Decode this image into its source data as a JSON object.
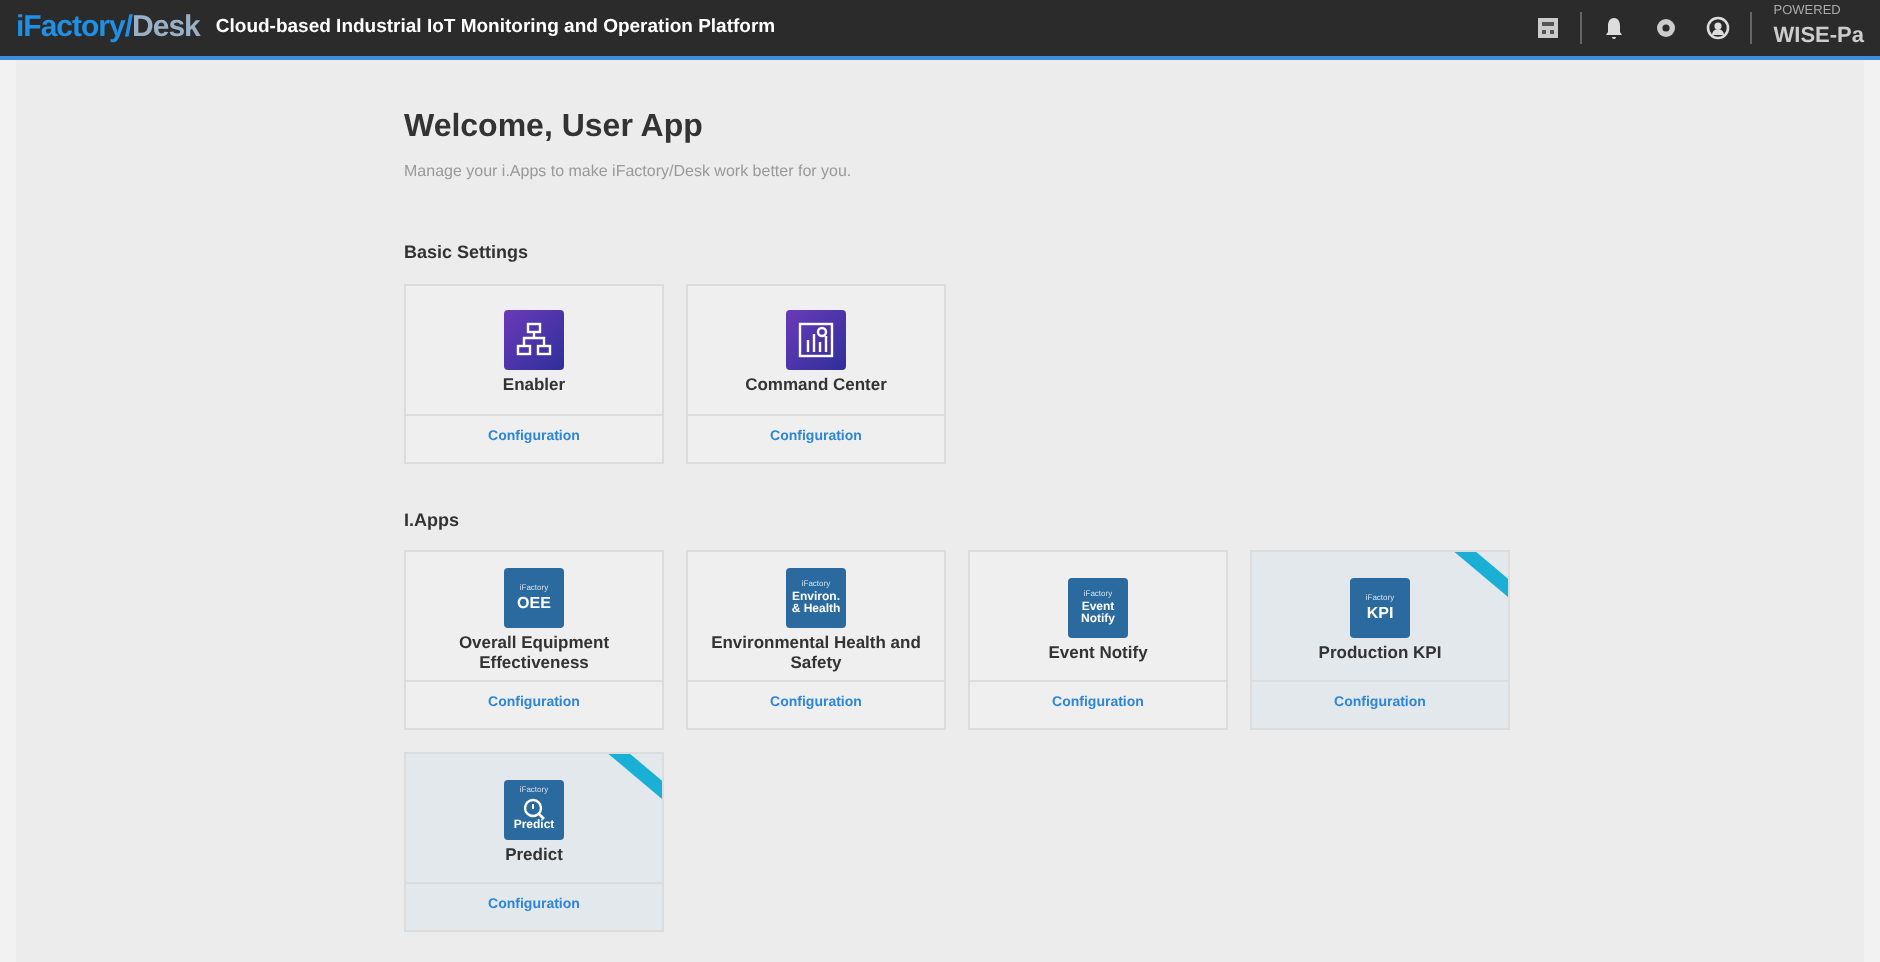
{
  "header": {
    "logo_main": "iFactory",
    "logo_slash": "/",
    "logo_desk": "Desk",
    "subtitle": "Cloud-based Industrial IoT Monitoring and Operation Platform",
    "powered_top": "POWERED",
    "powered_brand": "WISE-Pa"
  },
  "welcome": {
    "title": "Welcome, User App",
    "subtitle": "Manage your i.Apps to make iFactory/Desk work better for you."
  },
  "sections": [
    {
      "title": "Basic Settings",
      "apps": [
        {
          "name": "Enabler",
          "kind": "network",
          "action": "Configuration",
          "ribbon": false
        },
        {
          "name": "Command Center",
          "kind": "dashboard",
          "action": "Configuration",
          "ribbon": false
        }
      ]
    },
    {
      "title": "I.Apps",
      "apps": [
        {
          "name": "Overall Equipment Effectiveness",
          "kind": "label",
          "brand": "iFactory",
          "icon_lines": [
            "OEE"
          ],
          "action": "Configuration",
          "ribbon": false
        },
        {
          "name": "Environmental Health and Safety",
          "kind": "label",
          "brand": "iFactory",
          "icon_lines": [
            "Environ.",
            "& Health"
          ],
          "action": "Configuration",
          "ribbon": false
        },
        {
          "name": "Event Notify",
          "kind": "label",
          "brand": "iFactory",
          "icon_lines": [
            "Event",
            "Notify"
          ],
          "action": "Configuration",
          "ribbon": false
        },
        {
          "name": "Production KPI",
          "kind": "label",
          "brand": "iFactory",
          "icon_lines": [
            "KPI"
          ],
          "action": "Configuration",
          "ribbon": true
        },
        {
          "name": "Predict",
          "kind": "predict",
          "brand": "iFactory",
          "icon_lines": [
            "Predict"
          ],
          "action": "Configuration",
          "ribbon": true
        }
      ]
    }
  ]
}
